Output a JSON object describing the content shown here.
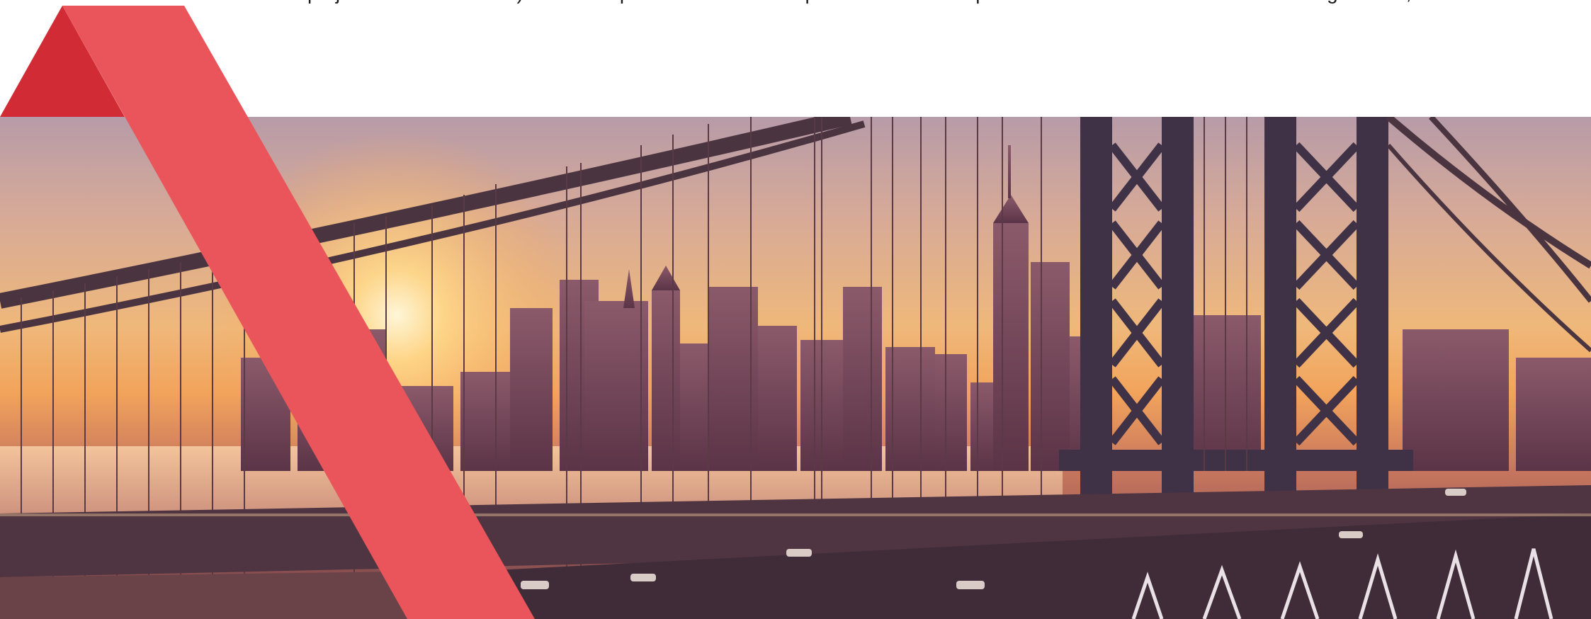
{
  "intro": {
    "left_column": {
      "line_cut_prefix": "",
      "line_cut_link": "",
      "line_cut_suffix": "",
      "line_visible": "projects without consent) will be disqualified from the competition."
    },
    "right_column": {
      "line_cut": "",
      "line_visible": "competition website for more details about registration, submission."
    }
  },
  "hero": {
    "subject": "city-skyline-through-suspension-bridge",
    "accent_color": "#e9555a",
    "accent_dark_color": "#d12c35"
  }
}
